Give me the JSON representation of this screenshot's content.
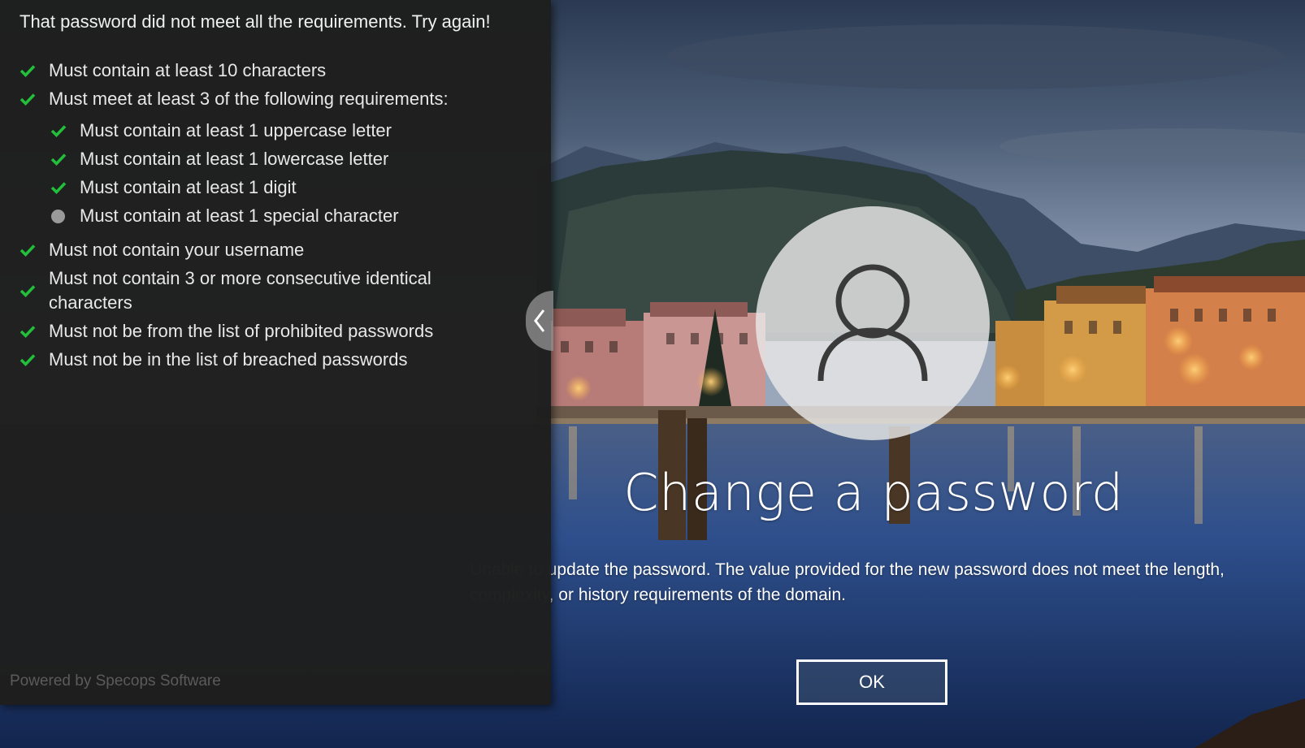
{
  "colors": {
    "check": "#22c03a",
    "unmet": "#9a9a9a",
    "panel_bg": "#1e1e1e",
    "text": "#e8e8e8"
  },
  "panel": {
    "heading": "That password did not meet all the requirements. Try again!",
    "requirements": [
      {
        "text": "Must contain at least 10 characters",
        "status": "met",
        "icon": "check-icon"
      },
      {
        "text": "Must meet at least 3 of the following requirements:",
        "status": "met",
        "icon": "check-icon"
      },
      {
        "text": "Must contain at least 1 uppercase letter",
        "status": "met",
        "icon": "check-icon",
        "sub": true
      },
      {
        "text": "Must contain at least 1 lowercase letter",
        "status": "met",
        "icon": "check-icon",
        "sub": true
      },
      {
        "text": "Must contain at least 1 digit",
        "status": "met",
        "icon": "check-icon",
        "sub": true
      },
      {
        "text": "Must contain at least 1 special character",
        "status": "unmet",
        "icon": "dot-icon",
        "sub": true
      },
      {
        "text": "Must not contain your username",
        "status": "met",
        "icon": "check-icon"
      },
      {
        "text": "Must not contain 3 or more consecutive identical characters",
        "status": "met",
        "icon": "check-icon"
      },
      {
        "text": "Must not be from the list of prohibited passwords",
        "status": "met",
        "icon": "check-icon"
      },
      {
        "text": "Must not be in the list of breached passwords",
        "status": "met",
        "icon": "check-icon"
      }
    ],
    "footer": "Powered by Specops Software"
  },
  "login": {
    "avatar_icon": "user-icon",
    "title": "Change a password",
    "message": "Unable to update the password. The value provided for the new password does not meet the length, complexity, or history requirements of the domain.",
    "ok_label": "OK"
  }
}
